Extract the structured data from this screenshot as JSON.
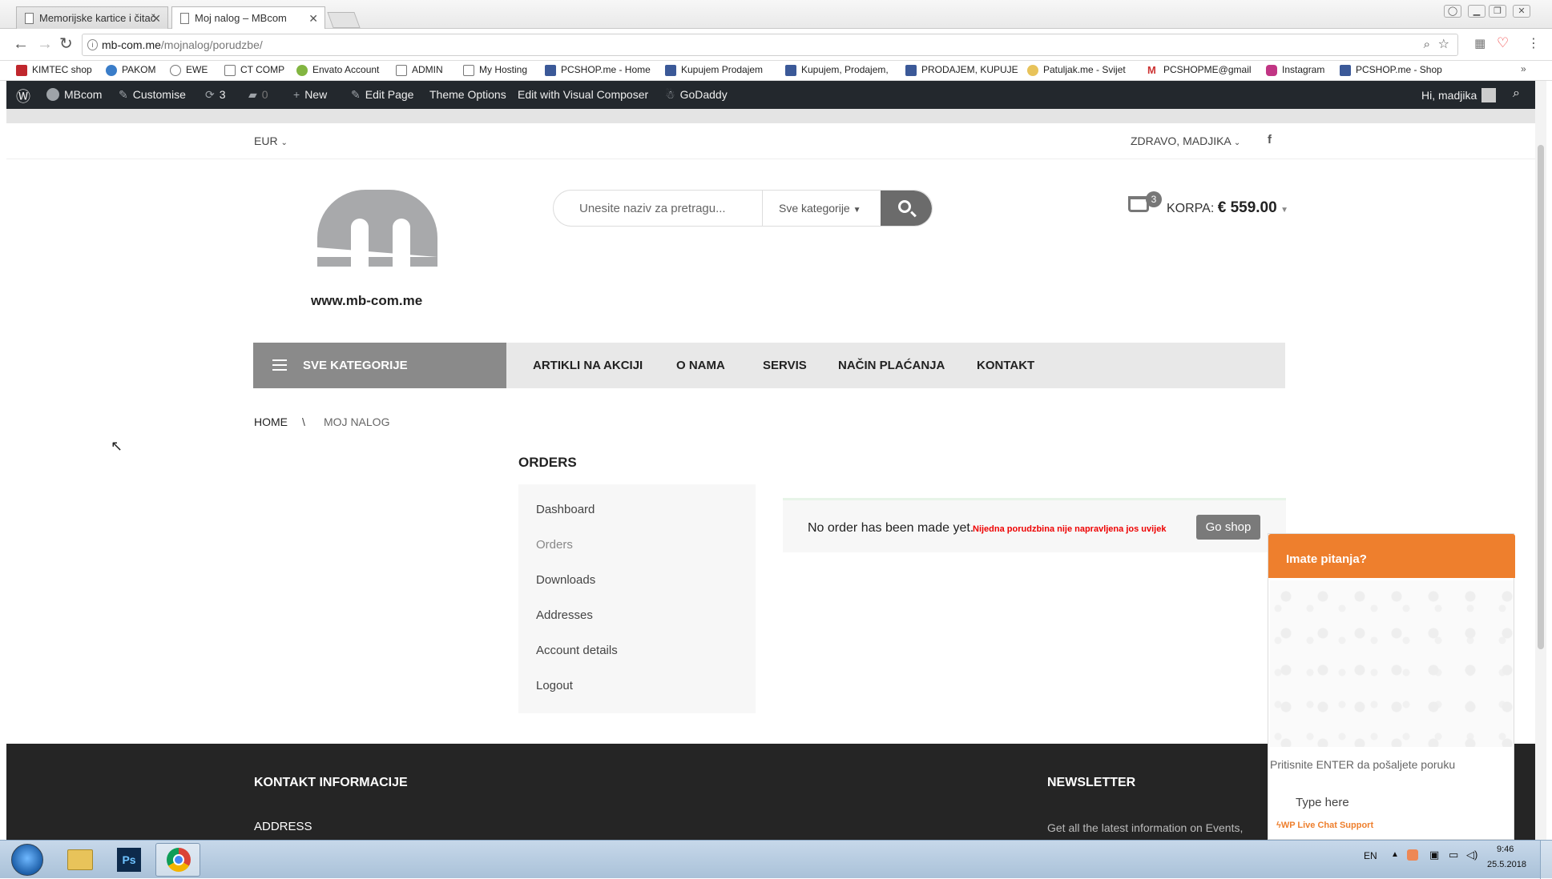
{
  "browser": {
    "tabs": [
      {
        "title": "Memorijske kartice i čitač"
      },
      {
        "title": "Moj nalog – MBcom"
      }
    ],
    "url_host": "mb-com.me",
    "url_path": "/mojnalog/porudzbe/",
    "bookmarks": [
      "KIMTEC shop",
      "PAKOM",
      "EWE",
      "CT COMP",
      "Envato Account",
      "ADMIN",
      "My Hosting",
      "PCSHOP.me - Home",
      "Kupujem Prodajem",
      "Kupujem, Prodajem,",
      "PRODAJEM, KUPUJE",
      "Patuljak.me - Svijet",
      "PCSHOPME@gmail",
      "Instagram",
      "PCSHOP.me - Shop"
    ]
  },
  "wpbar": {
    "site": "MBcom",
    "customise": "Customise",
    "updates": "3",
    "comments": "0",
    "new": "New",
    "edit_page": "Edit Page",
    "theme_options": "Theme Options",
    "visual_composer": "Edit with Visual Composer",
    "godaddy": "GoDaddy",
    "greeting": "Hi, madjika"
  },
  "topbar": {
    "currency": "EUR",
    "greeting": "ZDRAVO, MADJIKA"
  },
  "header": {
    "logo_text": "www.mb-com.me",
    "search_placeholder": "Unesite naziv za pretragu...",
    "search_category": "Sve kategorije",
    "cart_count": "3",
    "cart_label": "KORPA:",
    "cart_total": "€ 559.00"
  },
  "nav": {
    "all_categories": "SVE KATEGORIJE",
    "items": [
      "ARTIKLI NA AKCIJI",
      "O NAMA",
      "SERVIS",
      "NAČIN PLAĆANJA",
      "KONTAKT"
    ]
  },
  "breadcrumb": {
    "home": "HOME",
    "sep": "\\",
    "current": "MOJ NALOG"
  },
  "account": {
    "title": "ORDERS",
    "menu": [
      "Dashboard",
      "Orders",
      "Downloads",
      "Addresses",
      "Account details",
      "Logout"
    ],
    "notice": "No order has been made yet.",
    "notice_red": "Nijedna porudzbina nije napravljena jos uvijek",
    "go_shop": "Go shop"
  },
  "footer": {
    "contact_title": "KONTAKT INFORMACIJE",
    "address": "ADDRESS",
    "newsletter_title": "NEWSLETTER",
    "newsletter_text": "Get all the latest information on Events,"
  },
  "chat": {
    "title": "Imate pitanja?",
    "hint": "Pritisnite ENTER da pošaljete poruku",
    "placeholder": "Type here",
    "powered": "WP Live Chat Support"
  },
  "taskbar": {
    "lang": "EN",
    "time": "9:46",
    "date": "25.5.2018"
  },
  "colors": {
    "wpbar": "#23282d",
    "accent": "#ee7f2d",
    "footer": "#252525"
  }
}
